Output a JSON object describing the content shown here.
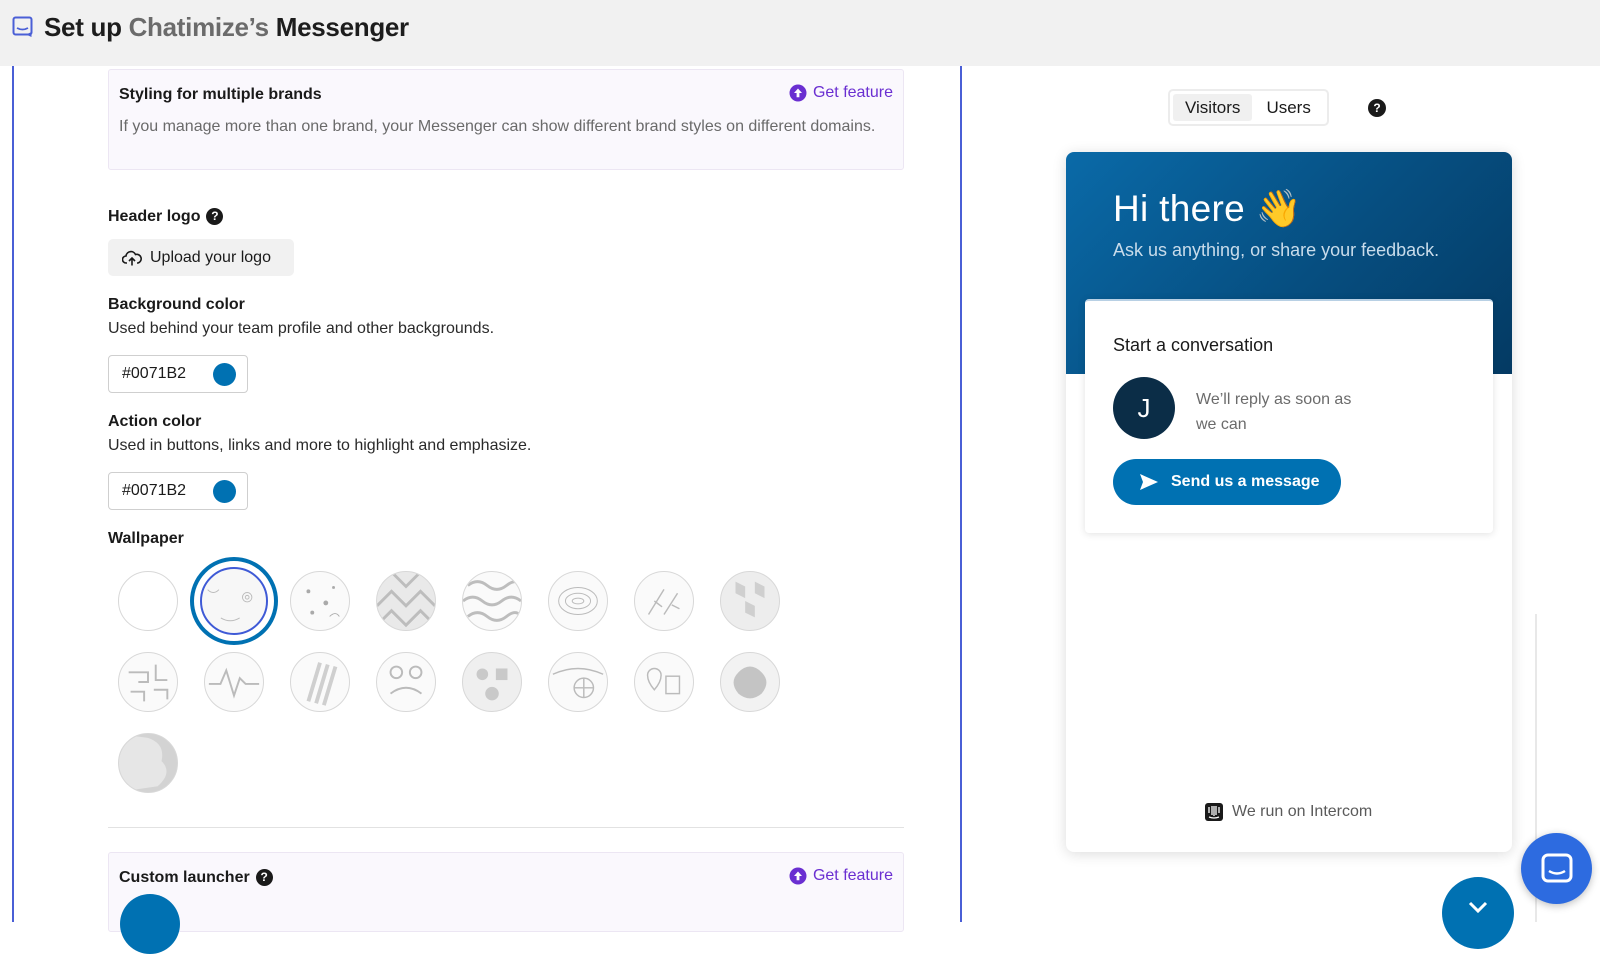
{
  "header": {
    "title_prefix": "Set up ",
    "brand_name": "Chatimize’s",
    "title_suffix": " Messenger",
    "icon": "chat-bubble-icon"
  },
  "brands": {
    "title": "Styling for multiple brands",
    "description": "If you manage more than one brand, your Messenger can show different brand styles on different domains.",
    "cta": "Get feature"
  },
  "header_logo": {
    "label": "Header logo",
    "upload_label": "Upload your logo"
  },
  "background_color": {
    "label": "Background color",
    "description": "Used behind your team profile and other backgrounds.",
    "value": "#0071B2"
  },
  "action_color": {
    "label": "Action color",
    "description": "Used in buttons, links and more to highlight and emphasize.",
    "value": "#0071B2"
  },
  "wallpaper": {
    "label": "Wallpaper",
    "selected_index": 1,
    "options": [
      "none",
      "doodle-swirl",
      "dots",
      "geometric",
      "squiggle",
      "topographic",
      "leaves",
      "cubes",
      "maze",
      "pulse",
      "stripes",
      "circles",
      "shapes",
      "globe",
      "location",
      "blob",
      "bubble"
    ]
  },
  "custom_launcher": {
    "label": "Custom launcher",
    "cta": "Get feature"
  },
  "preview": {
    "tabs": [
      "Visitors",
      "Users"
    ],
    "active_tab": "Visitors",
    "greeting": "Hi there 👋",
    "subtitle": "Ask us anything, or share your feedback.",
    "card_title": "Start a conversation",
    "avatar_initial": "J",
    "reply_text": "We’ll reply as soon as we can",
    "send_button": "Send us a message",
    "footer": "We run on Intercom"
  },
  "colors": {
    "brand": "#0071B2",
    "accent_purple": "#6a2fd1",
    "border_blue": "#4a5fd6"
  }
}
